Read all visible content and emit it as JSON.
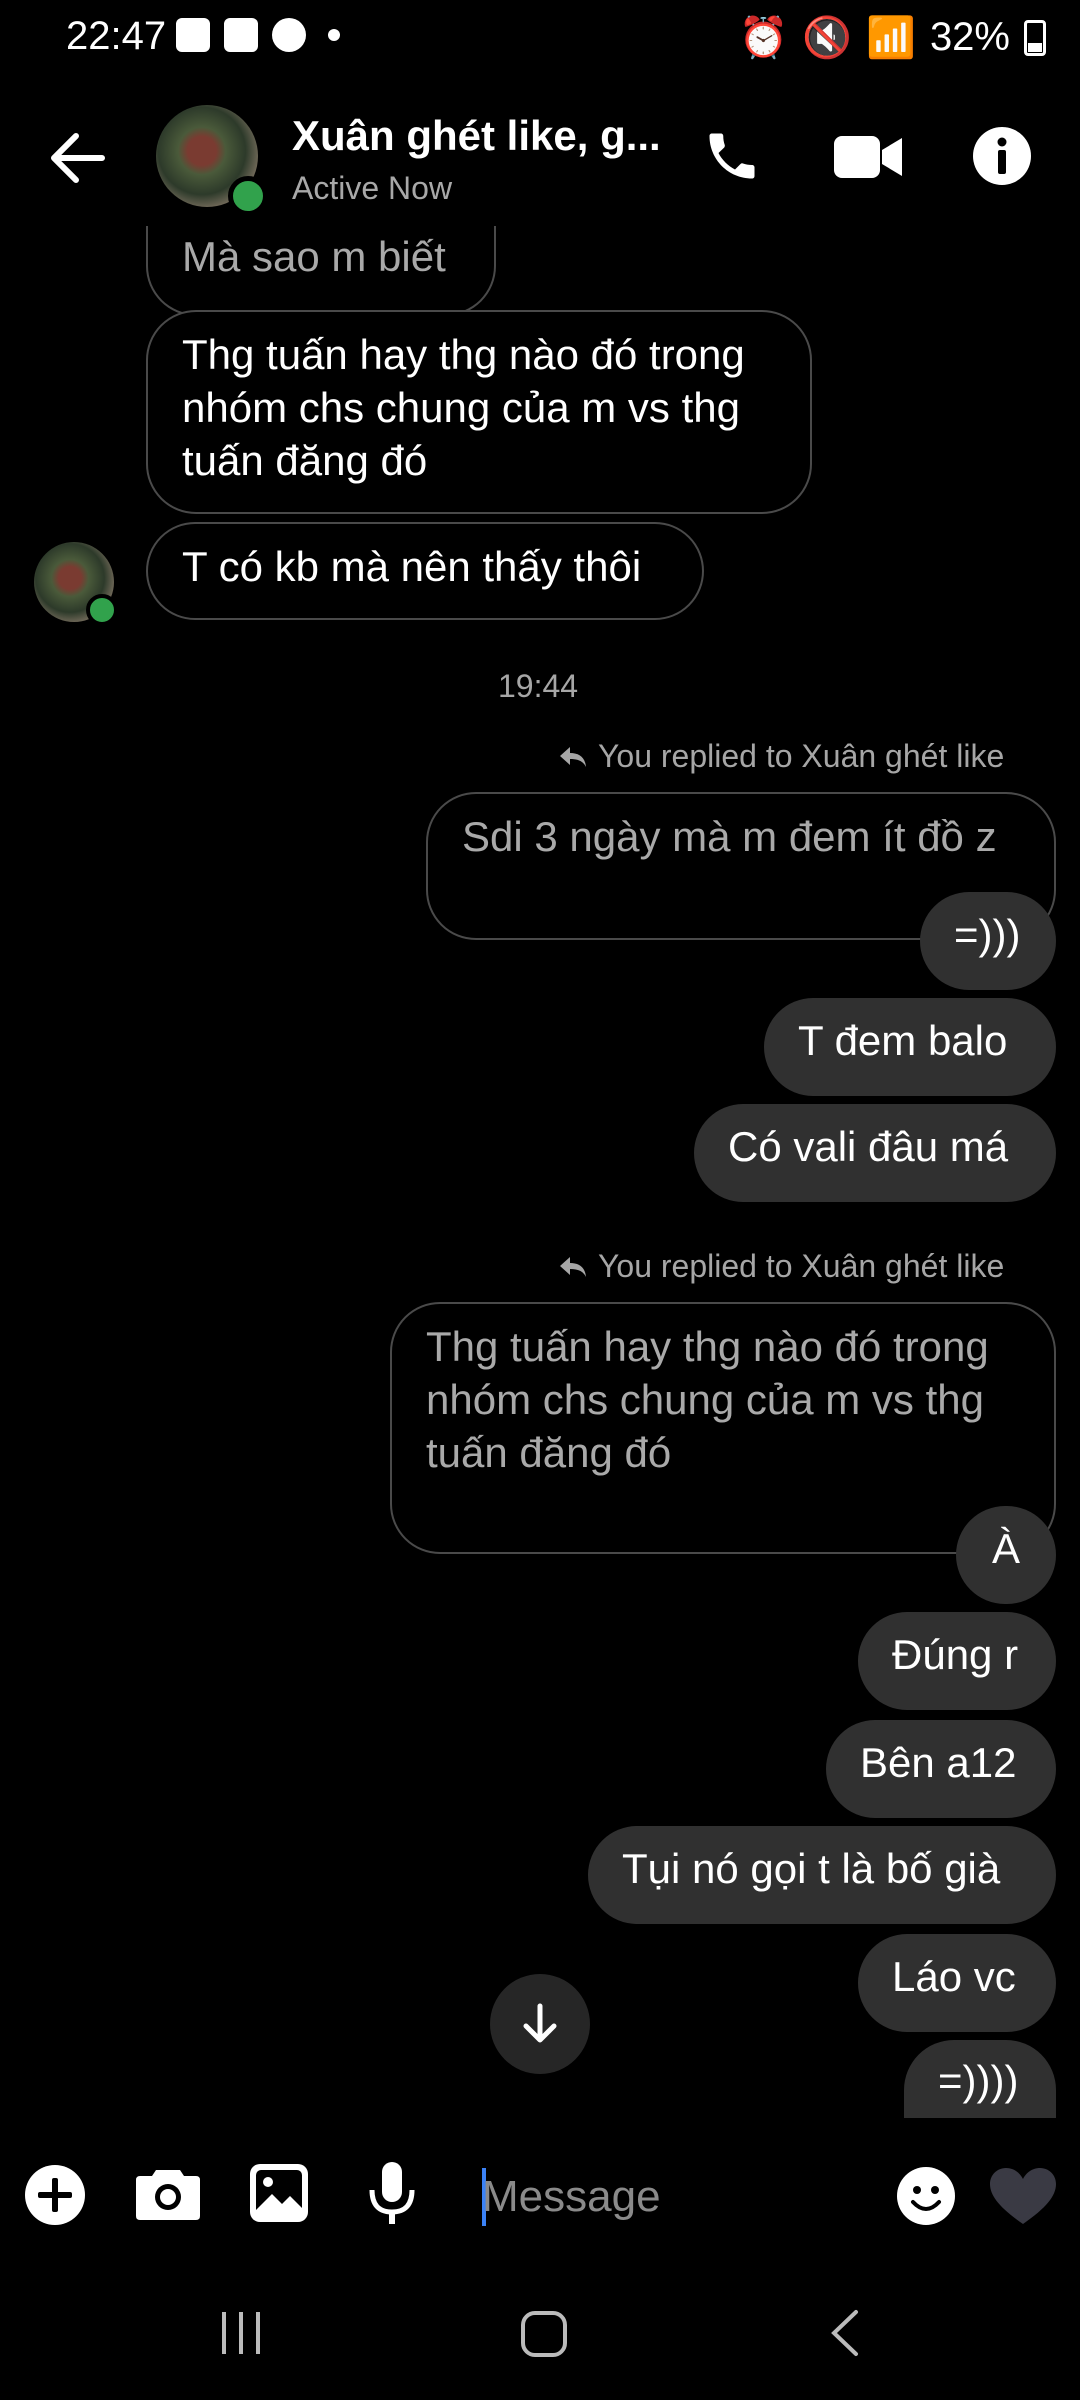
{
  "status_bar": {
    "time": "22:47",
    "battery": "32%"
  },
  "header": {
    "title": "Xuân ghét like, g...",
    "subtitle": "Active Now"
  },
  "messages": {
    "m1": "Mà sao m biết",
    "m2": "Thg tuấn hay thg nào đó trong nhóm chs chung của m vs thg tuấn đăng đó",
    "m3": "T có kb mà nên thấy thôi",
    "timestamp": "19:44",
    "reply1_label": "You replied to Xuân ghét like",
    "reply1_quote": "Sdi 3 ngày mà m đem ít đồ z",
    "o1": "=)))",
    "o2": "T đem balo",
    "o3": "Có vali đâu má",
    "reply2_label": "You replied to Xuân ghét like",
    "reply2_quote": "Thg tuấn hay thg nào đó trong nhóm chs chung của m vs thg tuấn đăng đó",
    "o4": "À",
    "o5": "Đúng r",
    "o6": "Bên a12",
    "o7": "Tụi nó gọi t là bố già",
    "o8": "Láo vc",
    "o9": "=))))"
  },
  "composer": {
    "placeholder": "Message"
  },
  "colors": {
    "bubble": "#303030",
    "online": "#31a24c",
    "caret": "#3b82f6"
  }
}
